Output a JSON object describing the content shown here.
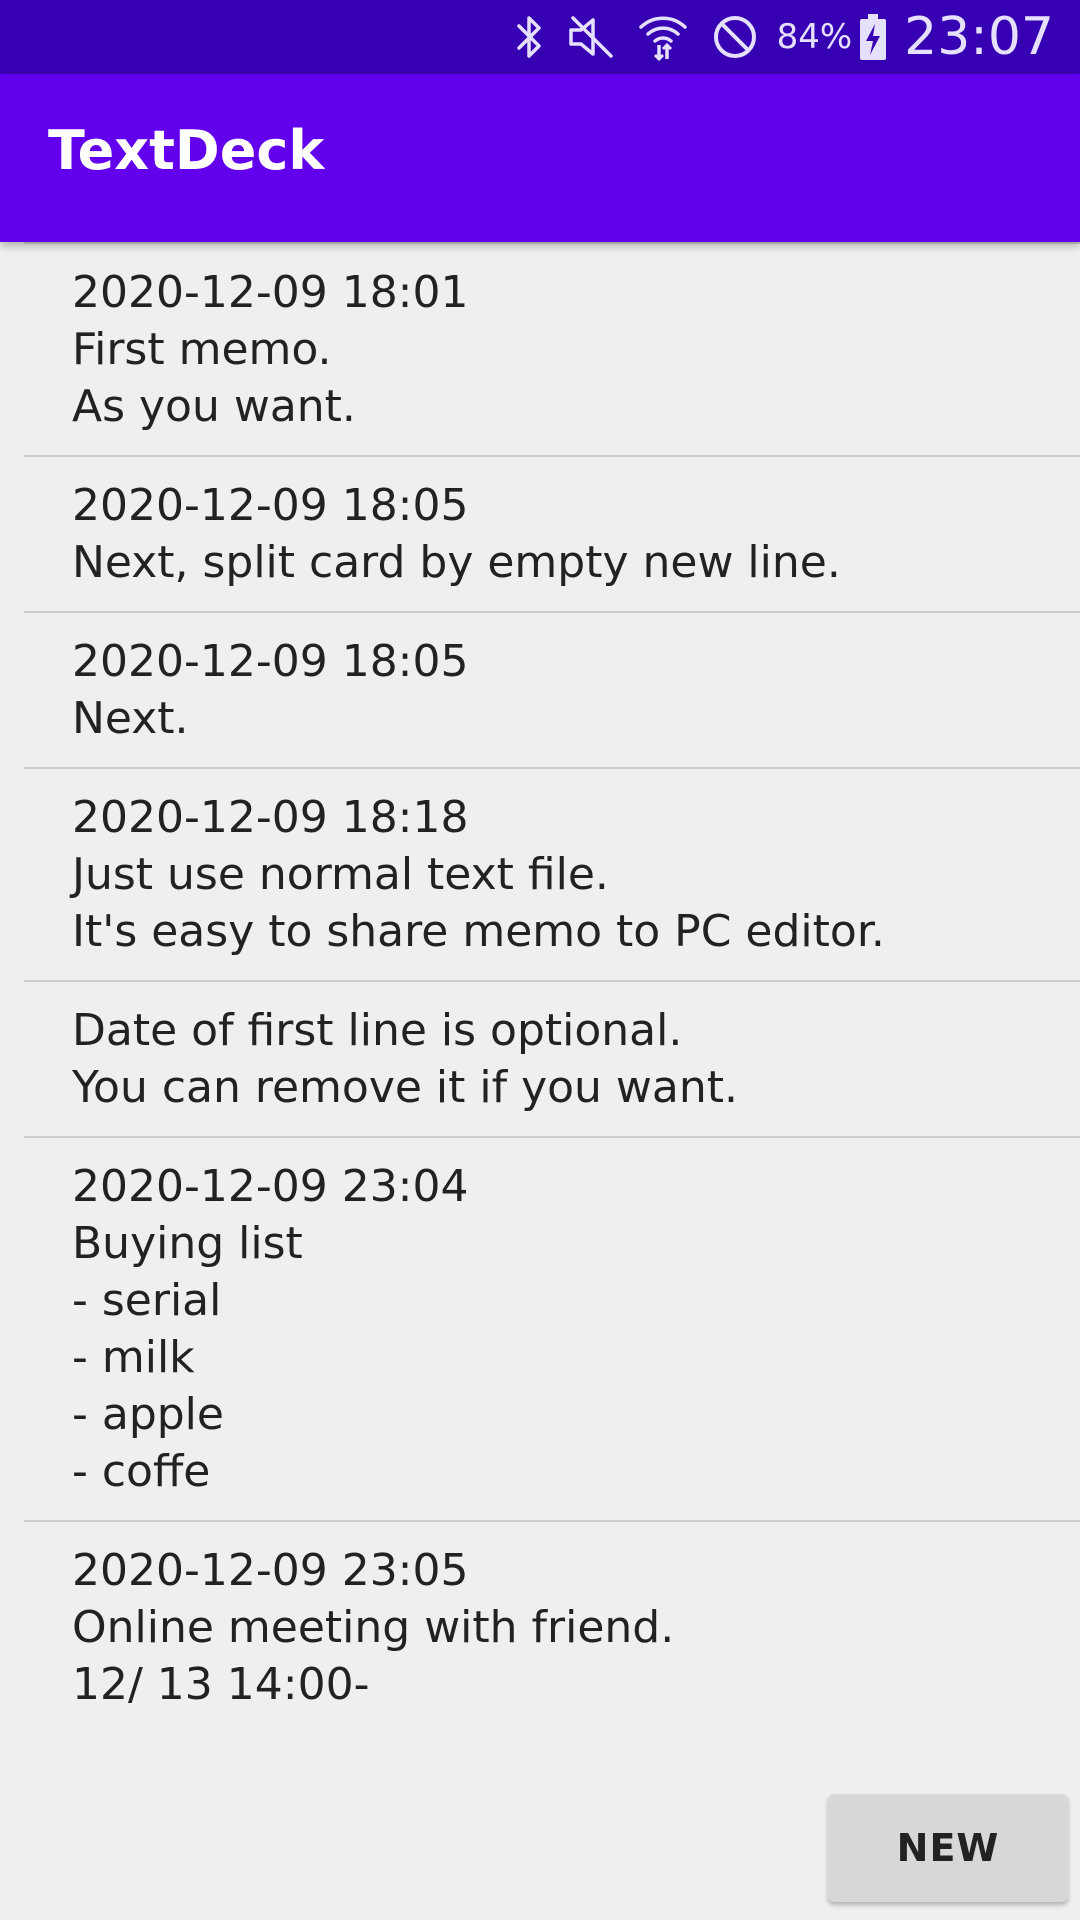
{
  "status_bar": {
    "battery_percent": "84%",
    "time": "23:07",
    "icons": [
      "bluetooth-icon",
      "mute-icon",
      "wifi-icon",
      "do-not-disturb-icon",
      "battery-charging-icon"
    ]
  },
  "app_bar": {
    "title": "TextDeck"
  },
  "memos": [
    {
      "lines": [
        "2020-12-09 18:01",
        "First memo.",
        "As you want."
      ]
    },
    {
      "lines": [
        "2020-12-09 18:05",
        "Next, split card by empty new line."
      ]
    },
    {
      "lines": [
        "2020-12-09 18:05",
        "Next."
      ]
    },
    {
      "lines": [
        "2020-12-09 18:18",
        "Just use normal text file.",
        "It's easy to share memo to PC editor."
      ]
    },
    {
      "lines": [
        "Date of first line is optional.",
        "You can remove it if you want."
      ]
    },
    {
      "lines": [
        "2020-12-09 23:04",
        "Buying list",
        "- serial",
        "- milk",
        "- apple",
        "- coffe"
      ]
    },
    {
      "lines": [
        "2020-12-09 23:05",
        "Online meeting with friend.",
        "12/ 13 14:00-"
      ]
    }
  ],
  "actions": {
    "new_label": "NEW"
  },
  "colors": {
    "status_bar": "#3700b3",
    "app_bar": "#6200ee",
    "background": "#efefef",
    "button": "#d6d7d7"
  }
}
